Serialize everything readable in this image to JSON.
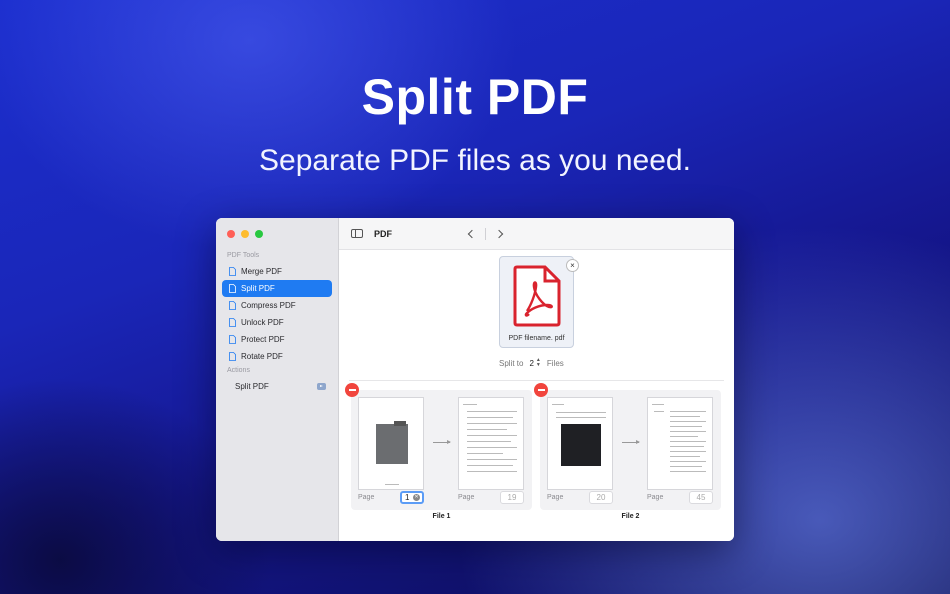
{
  "hero": {
    "title": "Split PDF",
    "subtitle": "Separate PDF files as you need."
  },
  "sidebar": {
    "section_tools": "PDF Tools",
    "items": [
      {
        "label": "Merge PDF",
        "icon": "document-icon",
        "active": false
      },
      {
        "label": "Split PDF",
        "icon": "document-icon",
        "active": true
      },
      {
        "label": "Compress PDF",
        "icon": "document-icon",
        "active": false
      },
      {
        "label": "Unlock PDF",
        "icon": "document-icon",
        "active": false
      },
      {
        "label": "Protect PDF",
        "icon": "document-icon",
        "active": false
      },
      {
        "label": "Rotate PDF",
        "icon": "document-icon",
        "active": false
      }
    ],
    "section_actions": "Actions",
    "actions": [
      {
        "label": "Split PDF",
        "icon": "run-icon"
      }
    ]
  },
  "toolbar": {
    "title": "PDF"
  },
  "file": {
    "name": "PDF filename. pdf",
    "close": "×"
  },
  "split": {
    "label": "Split to",
    "count": "2",
    "unit": "Files"
  },
  "groups": [
    {
      "caption": "File 1",
      "start_label": "Page",
      "start_value": "1",
      "end_label": "Page",
      "end_value": "19"
    },
    {
      "caption": "File 2",
      "start_label": "Page",
      "start_value": "20",
      "end_label": "Page",
      "end_value": "45"
    }
  ],
  "colors": {
    "accent": "#1f7bf2",
    "remove": "#f1453d",
    "pdf_red": "#d9232e"
  }
}
